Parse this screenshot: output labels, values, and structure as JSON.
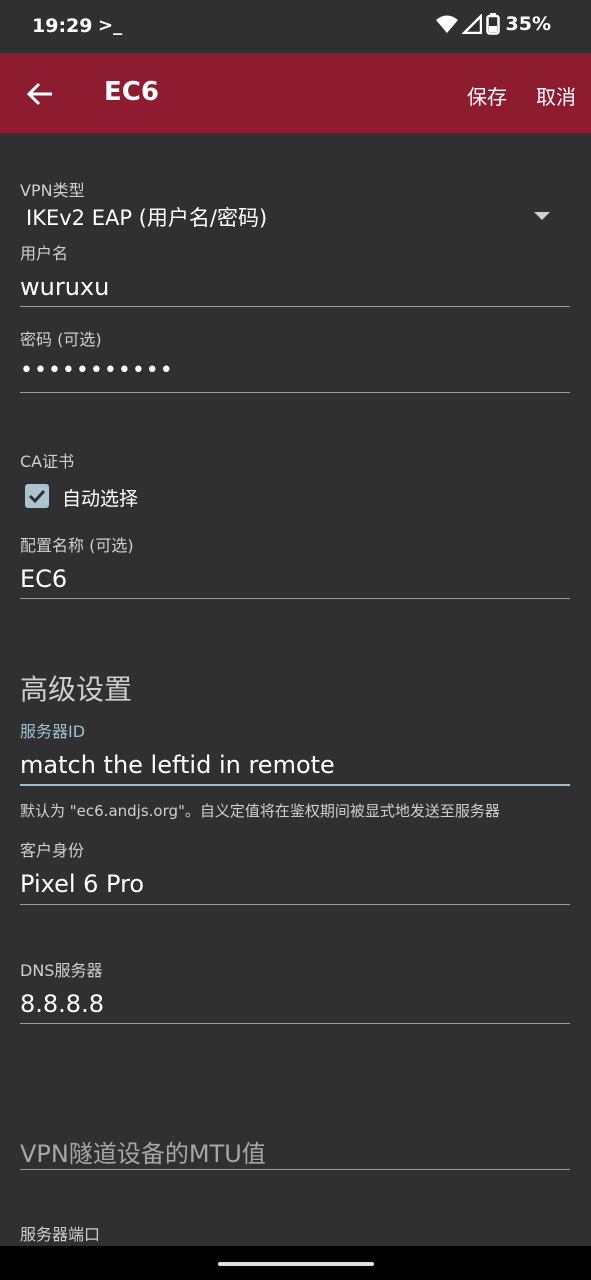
{
  "status_bar": {
    "time": "19:29",
    "terminal_glyph": ">_",
    "battery_percent": "35%",
    "icons": [
      "wifi-icon",
      "signal-icon",
      "battery-icon"
    ]
  },
  "app_bar": {
    "title": "EC6",
    "save_label": "保存",
    "cancel_label": "取消",
    "color": "#8e1c30"
  },
  "form": {
    "vpn_type": {
      "label": "VPN类型",
      "value": "IKEv2 EAP (用户名/密码)"
    },
    "username": {
      "label": "用户名",
      "value": "wuruxu"
    },
    "password": {
      "label": "密码 (可选)",
      "value": "•••••••••••"
    },
    "ca_cert": {
      "label": "CA证书",
      "auto_select_label": "自动选择",
      "auto_select_checked": true
    },
    "profile_name": {
      "label": "配置名称 (可选)",
      "value": "EC6"
    },
    "advanced": {
      "heading": "高级设置",
      "server_id": {
        "label": "服务器ID",
        "value": "match the leftid in remote",
        "help": "默认为 \"ec6.andjs.org\"。自义定值将在鉴权期间被显式地发送至服务器"
      },
      "client_identity": {
        "label": "客户身份",
        "value": "Pixel 6 Pro"
      },
      "dns_servers": {
        "label": "DNS服务器",
        "value": "8.8.8.8"
      },
      "mtu": {
        "placeholder": "VPN隧道设备的MTU值"
      },
      "server_port": {
        "label": "服务器端口"
      }
    }
  },
  "accent_color": "#9ec1cf",
  "background_color": "#303030"
}
